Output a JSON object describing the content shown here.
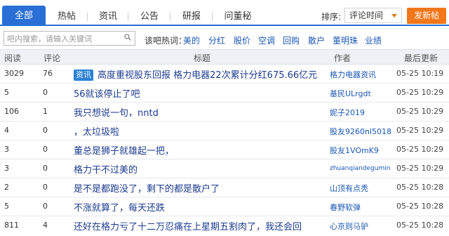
{
  "tabs": [
    {
      "label": "全部"
    },
    {
      "label": "热帖"
    },
    {
      "label": "资讯"
    },
    {
      "label": "公告"
    },
    {
      "label": "研报"
    },
    {
      "label": "问董秘"
    }
  ],
  "sort": {
    "label": "排序:",
    "selected": "评论时间"
  },
  "post_button": "发新帖",
  "search": {
    "placeholder": "吧内搜索，请输入关键词"
  },
  "hot": {
    "label": "该吧热词：",
    "items": [
      "美的",
      "分红",
      "股价",
      "空调",
      "回购",
      "散户",
      "董明珠",
      "业绩"
    ]
  },
  "columns": {
    "reads": "阅读",
    "comments": "评论",
    "title": "标题",
    "author": "作者",
    "updated": "最后更新"
  },
  "rows": [
    {
      "reads": "3029",
      "comments": "76",
      "badge": "资讯",
      "title": "高度重视股东回报 格力电器22次累计分红675.66亿元",
      "author": "格力电器资讯",
      "updated": "05-25 10:19"
    },
    {
      "reads": "5",
      "comments": "0",
      "badge": "",
      "title": "56就该停止了吧",
      "author": "基民ULrgdt",
      "updated": "05-25 10:29"
    },
    {
      "reads": "106",
      "comments": "1",
      "badge": "",
      "title": "我只想说一句，nntd",
      "author": "妮子2019",
      "updated": "05-25 10:29"
    },
    {
      "reads": "4",
      "comments": "0",
      "badge": "",
      "title": "，太垃圾啦",
      "author": "股友9260nl5018",
      "updated": "05-25 10:29"
    },
    {
      "reads": "3",
      "comments": "0",
      "badge": "",
      "title": "董总是狮子就雄起一把，",
      "author": "股友1VOmK9",
      "updated": "05-25 10:29"
    },
    {
      "reads": "3",
      "comments": "0",
      "badge": "",
      "title": "格力干不过美的",
      "author": "zhuanqiandegumin",
      "updated": "05-25 10:29"
    },
    {
      "reads": "2",
      "comments": "0",
      "badge": "",
      "title": "是不是都跑没了，剩下的都是散户了",
      "author": "山顶有点秃",
      "updated": "05-25 10:28"
    },
    {
      "reads": "5",
      "comments": "0",
      "badge": "",
      "title": "不涨就算了，每天还跌",
      "author": "春野软弹",
      "updated": "05-25 10:28"
    },
    {
      "reads": "811",
      "comments": "4",
      "badge": "",
      "title": "还好在格力亏了十二万忍痛在上星期五割肉了，我还会回",
      "author": "心京则马驴",
      "updated": "05-25 10:28"
    }
  ]
}
